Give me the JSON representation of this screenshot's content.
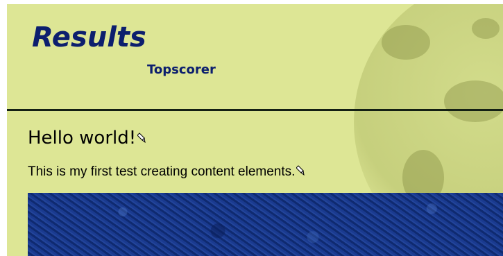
{
  "header": {
    "title": "Results",
    "subtitle": "Topscorer"
  },
  "content": {
    "heading": "Hello world!",
    "body_text": "This is my first test creating content elements.",
    "edit_icon": "pencil-icon"
  },
  "colors": {
    "background": "#dde695",
    "title": "#0c1f6e",
    "divider": "#142014",
    "image": "#133585"
  }
}
